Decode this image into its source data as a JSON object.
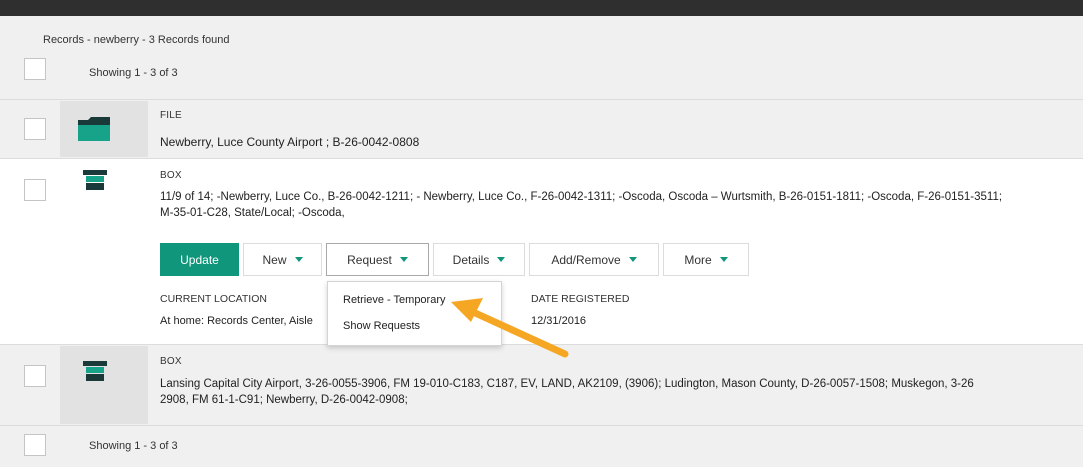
{
  "header": {
    "summary": "Records - newberry - 3 Records found",
    "showing": "Showing 1 - 3 of 3"
  },
  "records": [
    {
      "type": "FILE",
      "title": "Newberry, Luce County Airport ; B-26-0042-0808",
      "icon": "folder-icon"
    },
    {
      "type": "BOX",
      "line1": "11/9 of 14; -Newberry, Luce Co., B-26-0042-1211; - Newberry, Luce Co., F-26-0042-1311; -Oscoda, Oscoda – Wurtsmith, B-26-0151-1811; -Oscoda, F-26-0151-3511;",
      "line2": "M-35-01-C28, State/Local; -Oscoda,",
      "icon": "box-icon",
      "toolbar": {
        "update": "Update",
        "new": "New",
        "request": "Request",
        "details": "Details",
        "add_remove": "Add/Remove",
        "more": "More"
      },
      "current_location_label": "CURRENT LOCATION",
      "current_location_value": "At home: Records Center, Aisle",
      "date_registered_label": "DATE REGISTERED",
      "date_registered_value": "12/31/2016"
    },
    {
      "type": "BOX",
      "line1": "Lansing Capital City Airport, 3-26-0055-3906, FM 19-010-C183, C187, EV, LAND, AK2109, (3906); Ludington, Mason County, D-26-0057-1508; Muskegon, 3-26",
      "line2": "2908, FM 61-1-C91; Newberry, D-26-0042-0908;",
      "icon": "box-icon"
    }
  ],
  "request_menu": {
    "items": [
      "Retrieve - Temporary",
      "Show Requests"
    ]
  },
  "footer": {
    "showing": "Showing 1 - 3 of 3"
  },
  "colors": {
    "accent": "#10967a",
    "arrow": "#f5a623"
  }
}
